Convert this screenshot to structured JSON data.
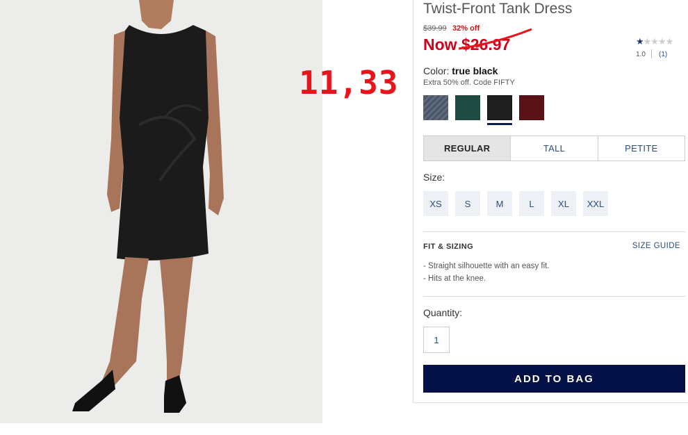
{
  "annotation": "11,33",
  "product": {
    "title": "Twist-Front Tank Dress",
    "old_price": "$39.99",
    "discount": "32% off",
    "now_price": "Now $26.97",
    "rating": {
      "stars": "★",
      "empty_stars": "★★★★",
      "value": "1.0",
      "count": "(1)"
    },
    "color_prefix": "Color: ",
    "color_name": "true black",
    "promo": "Extra 50% off. Code FIFTY",
    "swatches": [
      "slate-stripe",
      "dark-green",
      "true-black",
      "burgundy"
    ],
    "selected_swatch": "true-black",
    "fit_tabs": [
      "REGULAR",
      "TALL",
      "PETITE"
    ],
    "selected_fit": "REGULAR",
    "size_label": "Size:",
    "sizes": [
      "XS",
      "S",
      "M",
      "L",
      "XL",
      "XXL"
    ],
    "fit_heading": "FIT & SIZING",
    "size_guide": "SIZE GUIDE",
    "fit_details": [
      "- Straight silhouette with an easy fit.",
      "- Hits at the knee."
    ],
    "quantity_label": "Quantity:",
    "quantity": "1",
    "add_to_bag": "ADD TO BAG"
  },
  "colors": {
    "price_red": "#d0021b",
    "link_blue": "#2a4d84",
    "button_navy": "#031146"
  }
}
